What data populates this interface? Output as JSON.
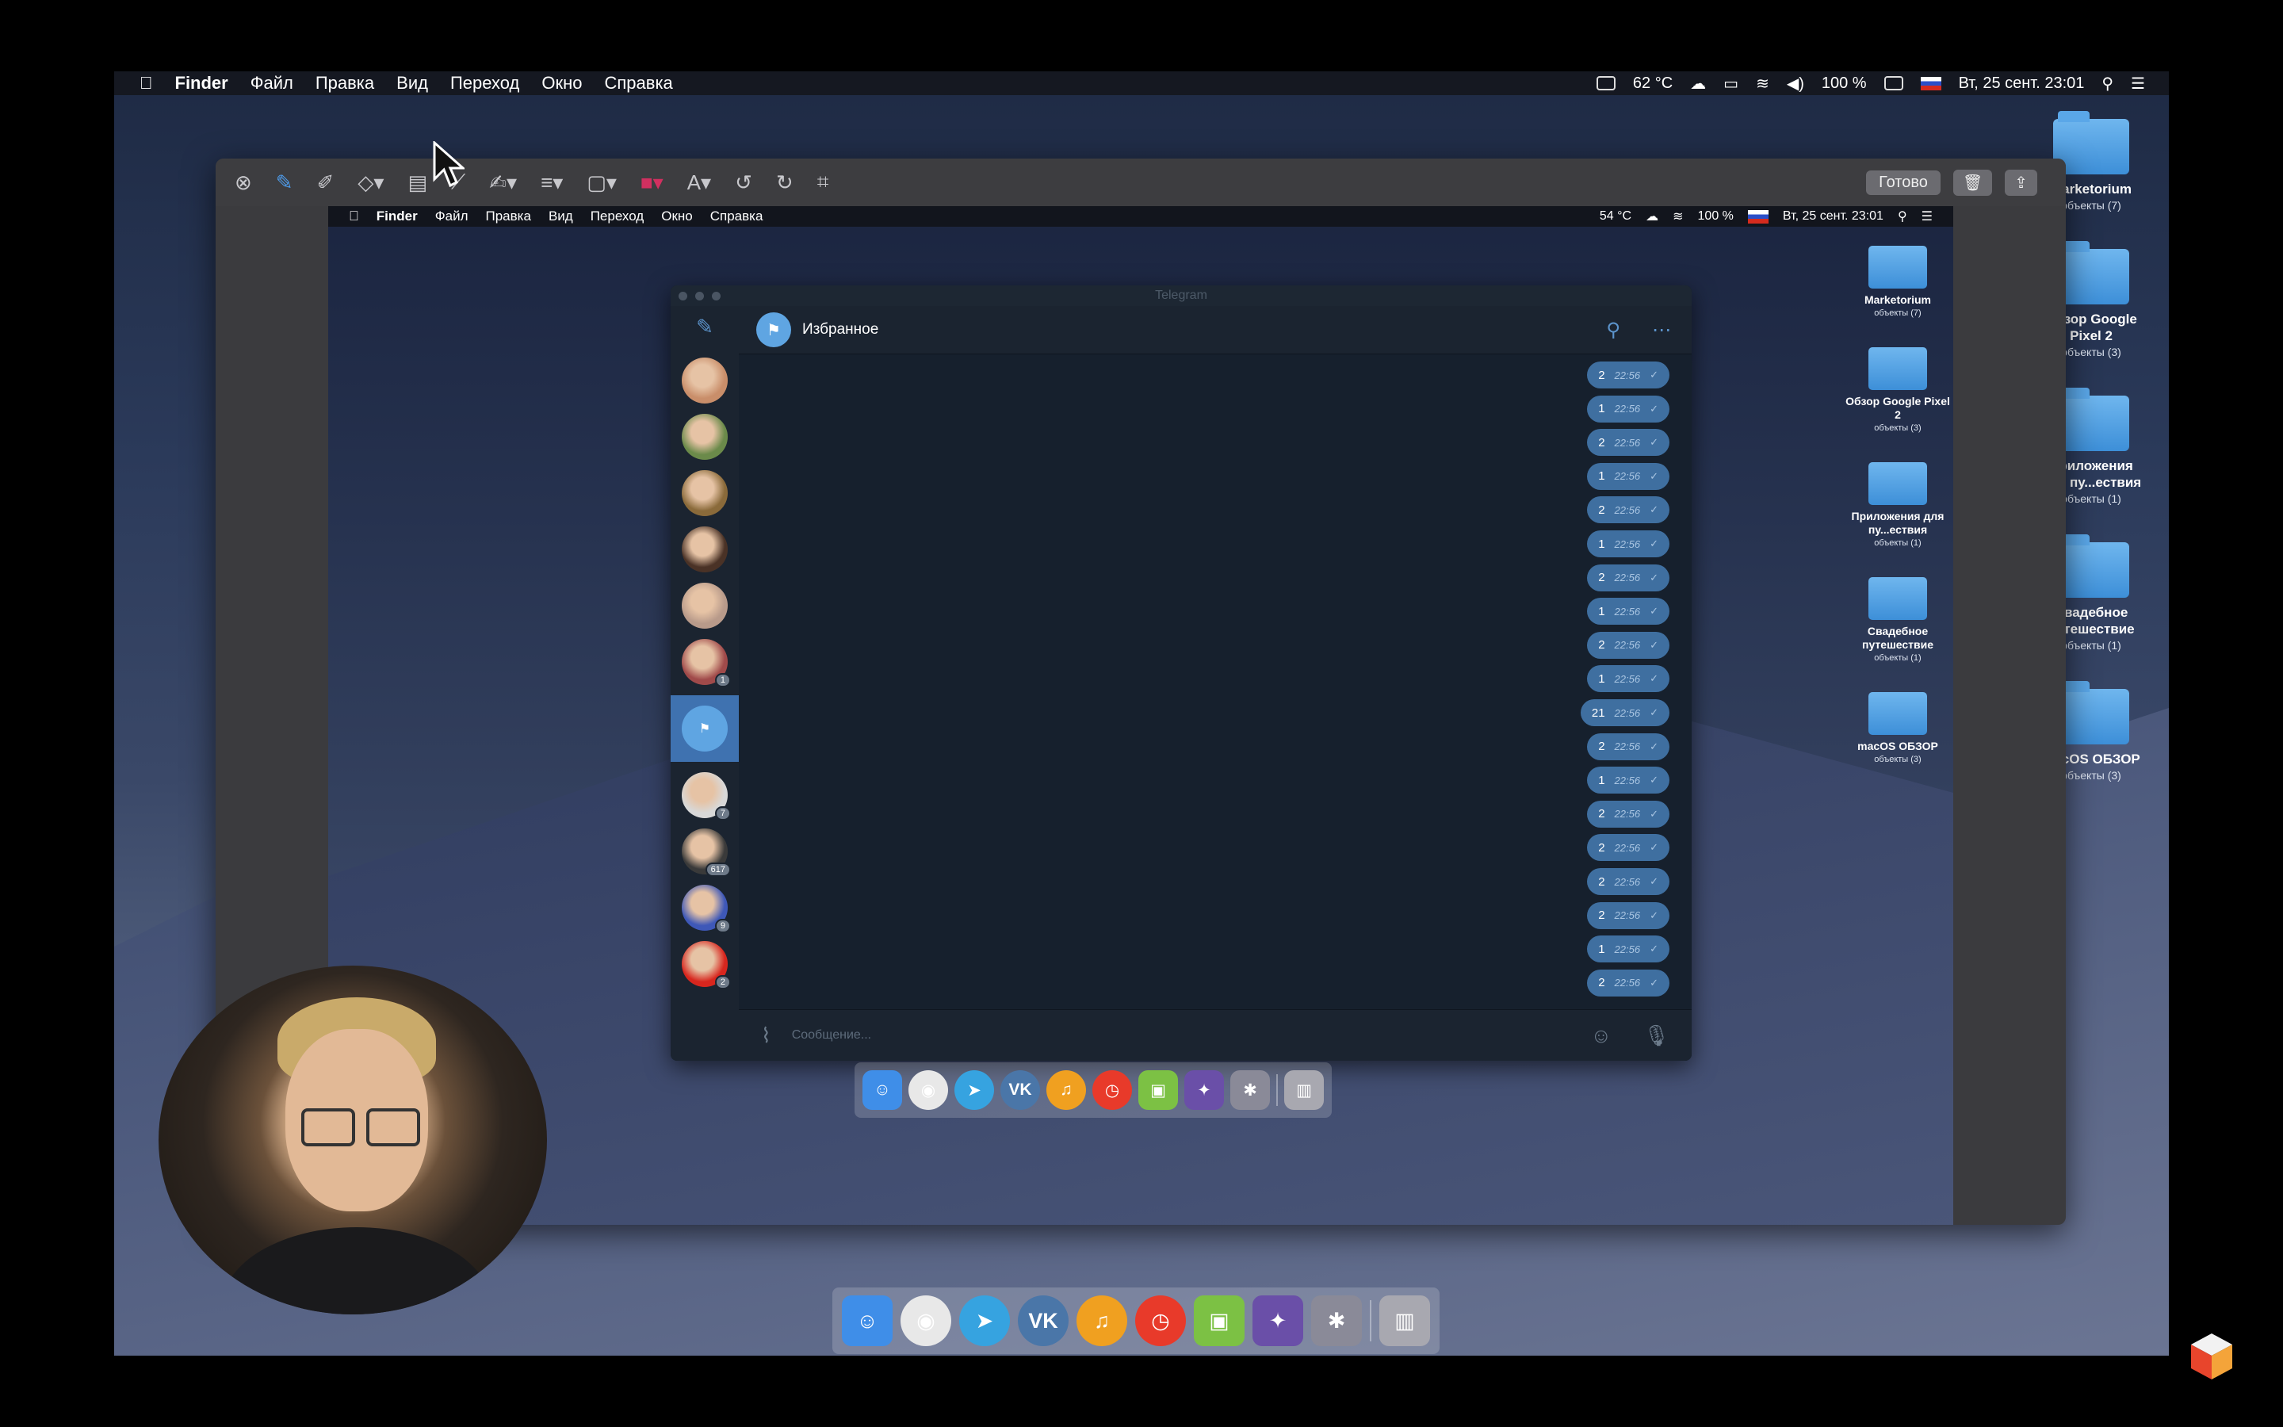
{
  "menubar": {
    "app_name": "Finder",
    "items": [
      "Файл",
      "Правка",
      "Вид",
      "Переход",
      "Окно",
      "Справка"
    ],
    "temp": "62 °C",
    "battery": "100 %",
    "datetime": "Вт, 25 сент. 23:01"
  },
  "desktop_folders": [
    {
      "name": "Marketorium",
      "sub": "объекты (7)"
    },
    {
      "name": "Обзор Google Pixel 2",
      "sub": "объекты (3)"
    },
    {
      "name": "Приложения для пу...ествия",
      "sub": "объекты (1)"
    },
    {
      "name": "Свадебное путешествие",
      "sub": "объекты (1)"
    },
    {
      "name": "macOS ОБЗОР",
      "sub": "объекты (3)"
    }
  ],
  "editor": {
    "done_label": "Готово"
  },
  "inner_menubar": {
    "app_name": "Finder",
    "items": [
      "Файл",
      "Правка",
      "Вид",
      "Переход",
      "Окно",
      "Справка"
    ],
    "temp": "54 °C",
    "battery": "100 %",
    "datetime": "Вт, 25 сент. 23:01"
  },
  "telegram": {
    "window_title": "Telegram",
    "chat_name": "Избранное",
    "input_placeholder": "Сообщение...",
    "avatars": [
      {
        "color": "#c98e6a",
        "badge": ""
      },
      {
        "color": "#6b8a4a",
        "badge": ""
      },
      {
        "color": "#8a6a3a",
        "badge": ""
      },
      {
        "color": "#4a3226",
        "badge": ""
      },
      {
        "color": "#b89a8a",
        "badge": ""
      },
      {
        "color": "#a04a4a",
        "badge": "1"
      },
      {
        "color": "selected",
        "badge": ""
      },
      {
        "color": "#d8d8d8",
        "badge": "7"
      },
      {
        "color": "#3a3a3a",
        "badge": "617"
      },
      {
        "color": "#3e58b8",
        "badge": "9"
      },
      {
        "color": "#d8261e",
        "badge": "2"
      }
    ],
    "messages": [
      {
        "text": "2",
        "time": "22:56"
      },
      {
        "text": "1",
        "time": "22:56"
      },
      {
        "text": "2",
        "time": "22:56"
      },
      {
        "text": "1",
        "time": "22:56"
      },
      {
        "text": "2",
        "time": "22:56"
      },
      {
        "text": "1",
        "time": "22:56"
      },
      {
        "text": "2",
        "time": "22:56"
      },
      {
        "text": "1",
        "time": "22:56"
      },
      {
        "text": "2",
        "time": "22:56"
      },
      {
        "text": "1",
        "time": "22:56"
      },
      {
        "text": "21",
        "time": "22:56"
      },
      {
        "text": "2",
        "time": "22:56"
      },
      {
        "text": "1",
        "time": "22:56"
      },
      {
        "text": "2",
        "time": "22:56"
      },
      {
        "text": "2",
        "time": "22:56"
      },
      {
        "text": "2",
        "time": "22:56"
      },
      {
        "text": "2",
        "time": "22:56"
      },
      {
        "text": "1",
        "time": "22:56"
      },
      {
        "text": "2",
        "time": "22:56"
      }
    ]
  },
  "dock_apps": [
    {
      "name": "finder",
      "color": "#3f8ee8",
      "glyph": "☺"
    },
    {
      "name": "chrome",
      "color": "#e8e8e8",
      "glyph": "◉"
    },
    {
      "name": "telegram",
      "color": "#36a3e0",
      "glyph": "➤"
    },
    {
      "name": "vk",
      "color": "#4a76a8",
      "glyph": "VK"
    },
    {
      "name": "music",
      "color": "#f0a020",
      "glyph": "♫"
    },
    {
      "name": "timer",
      "color": "#e83a2a",
      "glyph": "◷"
    },
    {
      "name": "android",
      "color": "#7cc144",
      "glyph": "▣"
    },
    {
      "name": "final-cut",
      "color": "#6a4fa8",
      "glyph": "✦"
    },
    {
      "name": "video",
      "color": "#8a8a98",
      "glyph": "✱"
    },
    {
      "name": "trash",
      "color": "#a8a8b0",
      "glyph": "▥"
    }
  ]
}
